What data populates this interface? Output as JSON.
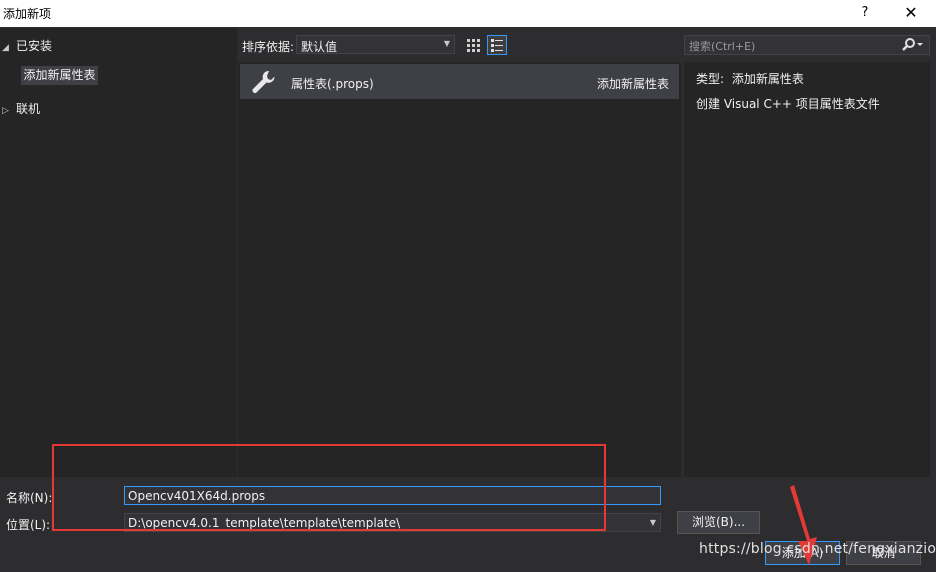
{
  "window": {
    "title": "添加新项",
    "help_label": "?",
    "close_label": "✕"
  },
  "tree": {
    "installed_label": "已安装",
    "installed_child": "添加新属性表",
    "online_label": "联机"
  },
  "toolbar": {
    "sort_label": "排序依据:",
    "sort_value": "默认值"
  },
  "search": {
    "placeholder": "搜索(Ctrl+E)"
  },
  "templates": [
    {
      "name": "属性表(.props)",
      "type": "添加新属性表",
      "icon": "wrench-icon"
    }
  ],
  "details": {
    "type_label": "类型:",
    "type_value": "添加新属性表",
    "description": "创建 Visual C++ 项目属性表文件"
  },
  "form": {
    "name_label": "名称(N):",
    "name_value": "Opencv401X64d.props",
    "location_label": "位置(L):",
    "location_value": "D:\\opencv4.0.1_template\\template\\template\\",
    "browse_label": "浏览(B)...",
    "add_label": "添加(A)",
    "cancel_label": "取消"
  },
  "watermark": "https://blog.csdn.net/fengxianzioo",
  "colors": {
    "background": "#2d2d30",
    "panel": "#252526",
    "selected": "#3f3f46",
    "highlight_border": "#e53935",
    "input_focus": "#3399ff"
  }
}
